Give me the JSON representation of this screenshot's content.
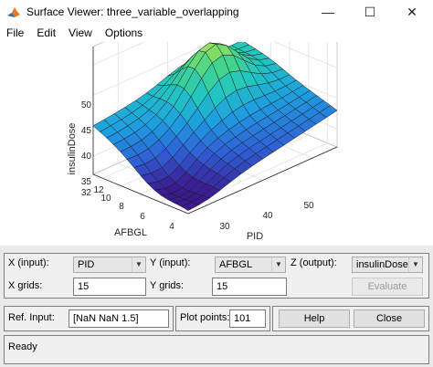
{
  "window": {
    "title": "Surface Viewer: three_variable_overlapping",
    "controls": {
      "minimize": "—",
      "maximize": "☐",
      "close": "✕"
    }
  },
  "menu": [
    "File",
    "Edit",
    "View",
    "Options"
  ],
  "plot": {
    "zlabel": "insulinDose",
    "xlabel": "PID",
    "ylabel": "AFBGL",
    "z_ticks": [
      "35",
      "40",
      "45",
      "50"
    ],
    "z_floor_label": "32",
    "y_ticks": [
      "12",
      "10",
      "8",
      "6",
      "4"
    ],
    "x_ticks": [
      "30",
      "40",
      "50"
    ],
    "colormap": [
      "#3b1a8f",
      "#2f5fd6",
      "#1e9fe0",
      "#22c6c0",
      "#45d68a",
      "#b7e64c",
      "#f6e94a"
    ]
  },
  "chart_data": {
    "type": "surface",
    "x_name": "PID",
    "y_name": "AFBGL",
    "z_name": "insulinDose",
    "x_range": [
      25,
      55
    ],
    "y_range": [
      3,
      13
    ],
    "z_range": [
      32,
      53
    ],
    "x_ticks": [
      30,
      40,
      50
    ],
    "y_ticks": [
      4,
      6,
      8,
      10,
      12
    ],
    "z_ticks": [
      35,
      40,
      45,
      50
    ],
    "grid": true,
    "approx_corner_values": {
      "PID_low_AFBGL_high": 40,
      "PID_low_AFBGL_low": 33,
      "PID_high_AFBGL_low": 38,
      "PID_high_AFBGL_high": 43,
      "peak": 52
    }
  },
  "controls": {
    "x_input_label": "X (input):",
    "x_input_value": "PID",
    "y_input_label": "Y (input):",
    "y_input_value": "AFBGL",
    "z_output_label": "Z (output):",
    "z_output_value": "insulinDose",
    "x_grids_label": "X grids:",
    "x_grids_value": "15",
    "y_grids_label": "Y grids:",
    "y_grids_value": "15",
    "evaluate_label": "Evaluate",
    "ref_input_label": "Ref. Input:",
    "ref_input_value": "[NaN NaN 1.5]",
    "plot_points_label": "Plot points:",
    "plot_points_value": "101",
    "help_label": "Help",
    "close_label": "Close",
    "status_text": "Ready"
  }
}
